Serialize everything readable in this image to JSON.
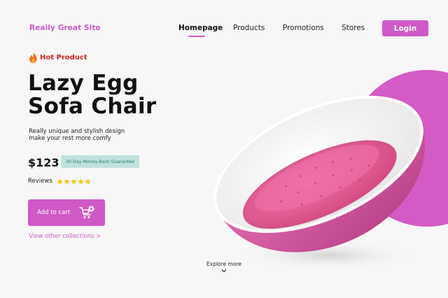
{
  "header": {
    "brand": "Really Great Site",
    "nav": [
      {
        "label": "Homepage",
        "active": true
      },
      {
        "label": "Products",
        "active": false
      },
      {
        "label": "Promotions",
        "active": false
      },
      {
        "label": "Stores",
        "active": false
      }
    ],
    "login_label": "Login"
  },
  "hero": {
    "badge": "Hot Product",
    "title_line1": "Lazy Egg",
    "title_line2": "Sofa Chair",
    "desc_line1": "Really unique and stylish design",
    "desc_line2": "make your rest more comfy",
    "price": "$123",
    "guarantee": "30 Day Money-Back Guarantee",
    "reviews_label": "Reviews",
    "rating": 5,
    "cart_label": "Add to cart",
    "other_link": "View other collections >",
    "explore_label": "Explore more"
  },
  "colors": {
    "accent": "#cf59c6",
    "fire": "#f26a1b",
    "star": "#f5c518",
    "cushion": "#e0508f",
    "badge_bg": "#bfe3dc",
    "badge_text": "#1f7b6d"
  },
  "icons": {
    "badge": "fire-icon",
    "cart": "cart-add-icon",
    "explore": "chevron-down-icon",
    "rating": "star-icon"
  }
}
